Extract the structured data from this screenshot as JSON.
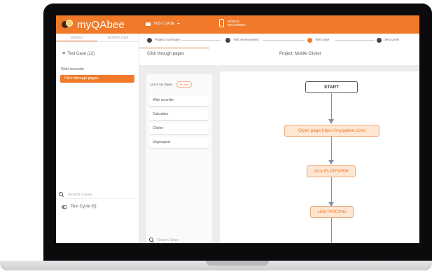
{
  "app": {
    "brand": "myQAbee"
  },
  "topbar": {
    "case_selector": "TEST CASE",
    "mobile_lines": [
      "MOBILE",
      "RECORDER"
    ]
  },
  "sidebar": {
    "tabs": [
      "MOBILE",
      "WORKFLOWS"
    ],
    "test_case_label": "Test Case (12)",
    "group_label": "Web recorder",
    "selected_item": "Click through pages",
    "search_placeholder": "Search Cases",
    "test_cycle_label": "Test Cycle (0)"
  },
  "steps": [
    {
      "label": "Project summary"
    },
    {
      "label": "Test environment"
    },
    {
      "label": "Test case"
    },
    {
      "label": "Test cycle"
    }
  ],
  "context": {
    "left": "Click through pages",
    "right": "Project: Mobile Clicker"
  },
  "steps_panel": {
    "title": "List of my Steps",
    "add_label": "Add",
    "groups": [
      "Web recorder",
      "Calculator",
      "Clicker",
      "Ungrouped"
    ],
    "search_placeholder": "Search Steps"
  },
  "flow": {
    "nodes": [
      {
        "label": "START",
        "kind": "start"
      },
      {
        "label": "Open page https://myqabee.com/",
        "kind": "action"
      },
      {
        "label": "click PLATFORM",
        "kind": "action"
      },
      {
        "label": "click PRICING",
        "kind": "action"
      }
    ]
  },
  "colors": {
    "accent": "#f07a2a",
    "node_fill": "#fde6d2",
    "connector": "#7f93a8"
  }
}
